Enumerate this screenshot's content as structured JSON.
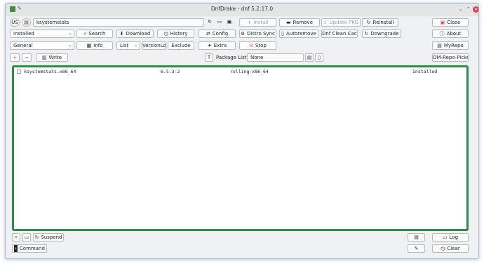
{
  "window": {
    "title": "DnfDrake - dnf 5.2.17.0"
  },
  "toolbar": {
    "lang_badge": "US",
    "search_value": "ksystemstats",
    "search_placeholder": "",
    "install_label": "Install",
    "remove_label": "Remove",
    "update_pkg_label": "Update PKG",
    "reinstall_label": "Reinstall",
    "close_label": "Close",
    "filter_select": "Installed",
    "search_label": "Search",
    "download_label": "Download",
    "history_label": "History",
    "config_label": "Config",
    "distro_sync_label": "Distro Sync",
    "autoremove_label": "Autoremove",
    "clean_cache_label": "Dnf Clean Cache",
    "downgrade_label": "Downgrade",
    "about_label": "About",
    "group_select": "General",
    "info_label": "Info",
    "view_select": "List",
    "versionlock_label": "VersionLock",
    "exclude_label": "Exclude",
    "extra_label": "Extra",
    "stop_label": "Stop",
    "myrepo_label": "MyRepo",
    "plus_label": "+",
    "minus_label": "−",
    "write_label": "Write",
    "package_list_label": "Package List:",
    "package_list_value": "None",
    "om_repo_picker_label": "OM-Repo-Picker"
  },
  "packages": [
    {
      "name": "ksystemstats.x86_64",
      "version": "6.5.3-2",
      "repo": "rolling-x86_64",
      "status": "Installed"
    }
  ],
  "bottom": {
    "suspend_label": "Suspend",
    "log_label": "Log",
    "command_label": "Command",
    "clear_label": "Clear"
  },
  "colors": {
    "list_border": "#2e8b4e",
    "close_button": "#da4453"
  },
  "icons": [
    "app-icon",
    "pin-icon",
    "minimize-icon",
    "maximize-icon",
    "close-icon",
    "repo-icon",
    "refresh-icon",
    "folder-icon",
    "save-icon",
    "plus-icon",
    "minus-icon",
    "x-icon",
    "search-icon",
    "download-icon",
    "history-icon",
    "config-icon",
    "sync-icon",
    "trash-icon",
    "downgrade-icon",
    "info-icon",
    "star-icon",
    "stop-icon",
    "repo-icon",
    "write-icon",
    "text-icon",
    "document-icon",
    "settings-icon",
    "suspend-icon",
    "log-icon",
    "terminal-icon",
    "eraser-icon"
  ]
}
